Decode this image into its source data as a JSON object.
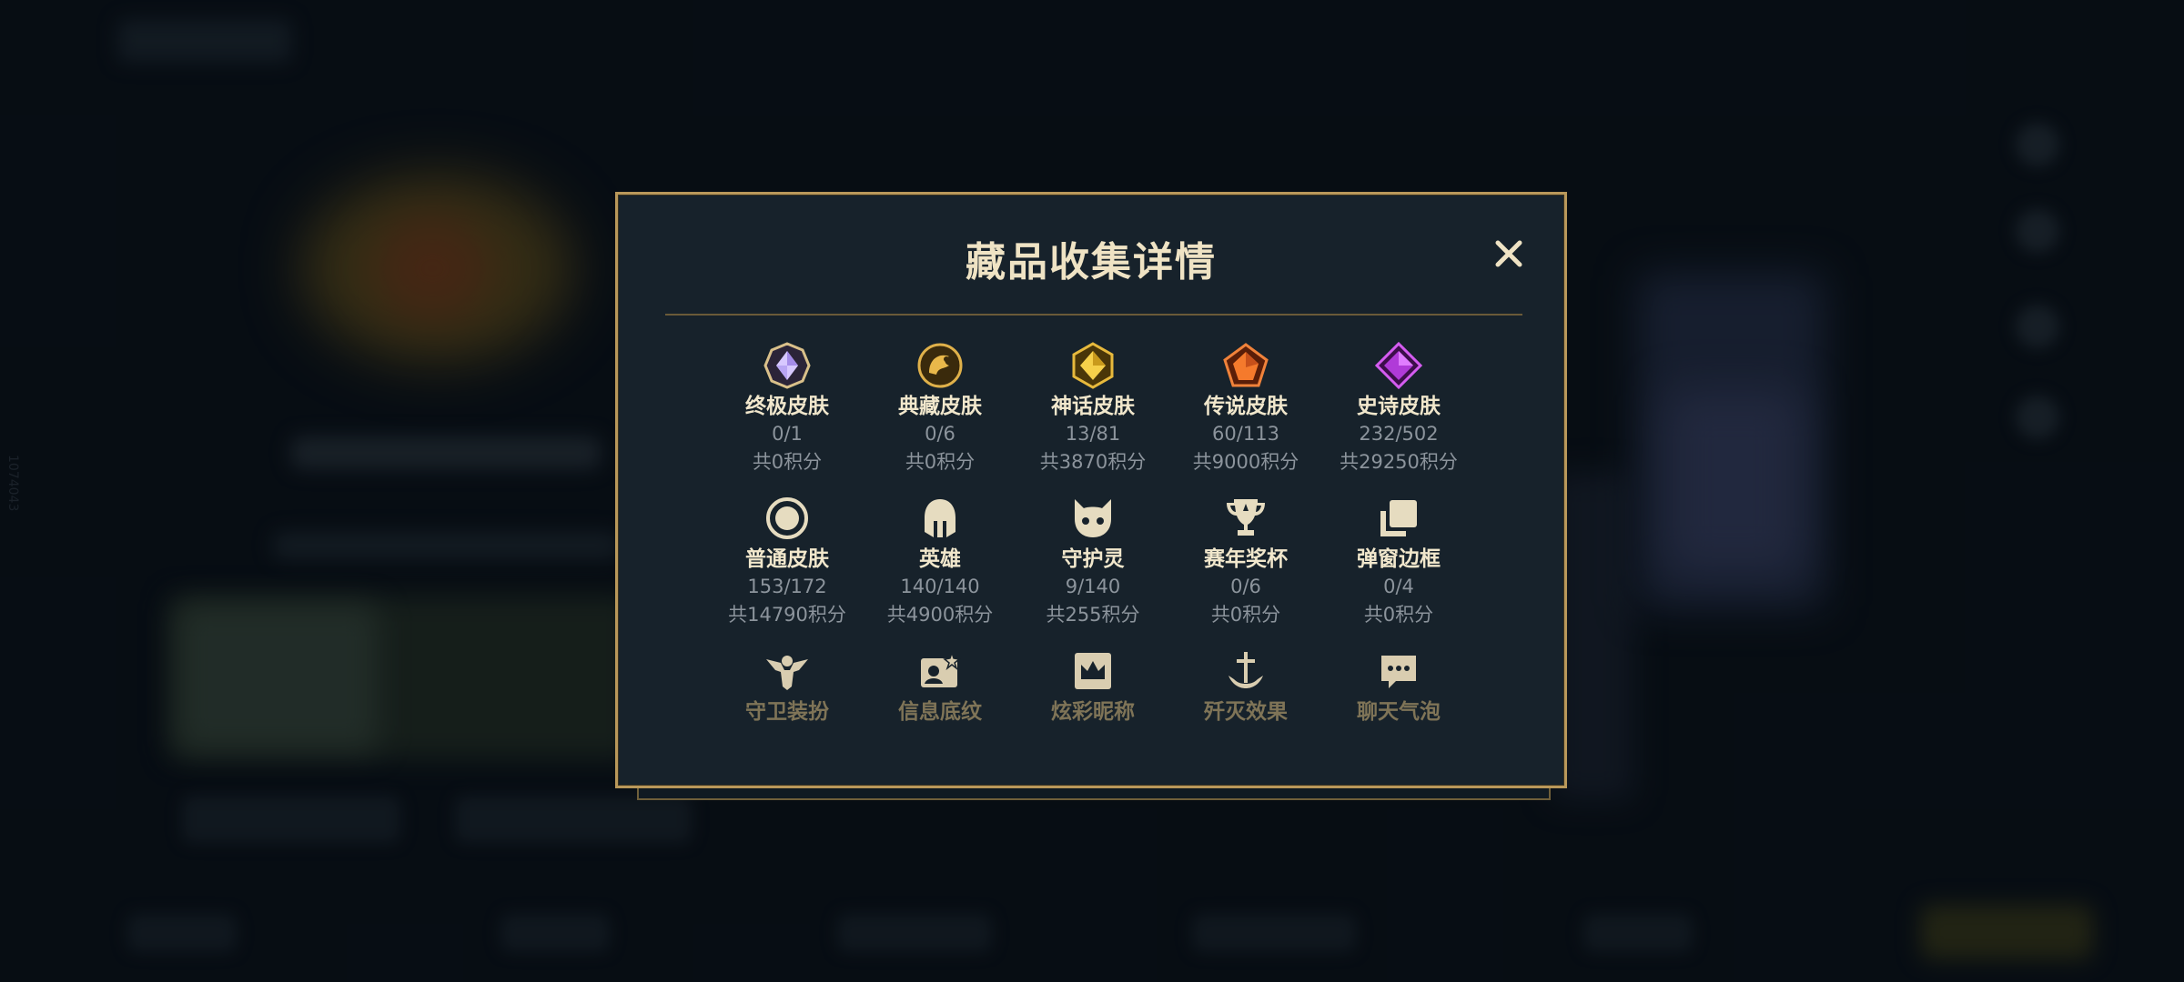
{
  "background": {
    "side_id": "1074043"
  },
  "modal": {
    "title": "藏品收集详情",
    "close_icon": "close-icon",
    "items": [
      {
        "icon": "ultimate-skin-icon",
        "name": "终极皮肤",
        "count": "0/1",
        "points": "共0积分"
      },
      {
        "icon": "collector-skin-icon",
        "name": "典藏皮肤",
        "count": "0/6",
        "points": "共0积分"
      },
      {
        "icon": "mythic-skin-icon",
        "name": "神话皮肤",
        "count": "13/81",
        "points": "共3870积分"
      },
      {
        "icon": "legendary-skin-icon",
        "name": "传说皮肤",
        "count": "60/113",
        "points": "共9000积分"
      },
      {
        "icon": "epic-skin-icon",
        "name": "史诗皮肤",
        "count": "232/502",
        "points": "共29250积分"
      },
      {
        "icon": "normal-skin-icon",
        "name": "普通皮肤",
        "count": "153/172",
        "points": "共14790积分"
      },
      {
        "icon": "hero-helmet-icon",
        "name": "英雄",
        "count": "140/140",
        "points": "共4900积分"
      },
      {
        "icon": "guardian-spirit-icon",
        "name": "守护灵",
        "count": "9/140",
        "points": "共255积分"
      },
      {
        "icon": "season-trophy-icon",
        "name": "赛年奖杯",
        "count": "0/6",
        "points": "共0积分"
      },
      {
        "icon": "popup-frame-icon",
        "name": "弹窗边框",
        "count": "0/4",
        "points": "共0积分"
      }
    ],
    "faded_items": [
      {
        "icon": "guard-outfit-icon",
        "name": "守卫装扮"
      },
      {
        "icon": "info-card-icon",
        "name": "信息底纹"
      },
      {
        "icon": "nickname-crown-icon",
        "name": "炫彩昵称"
      },
      {
        "icon": "annihilation-effect-icon",
        "name": "歼灭效果"
      },
      {
        "icon": "chat-bubble-icon",
        "name": "聊天气泡"
      }
    ]
  },
  "colors": {
    "gold_border": "#b9985a",
    "title_text": "#efe3c4",
    "muted_text": "#8c949c",
    "panel_bg": "#17222b"
  }
}
